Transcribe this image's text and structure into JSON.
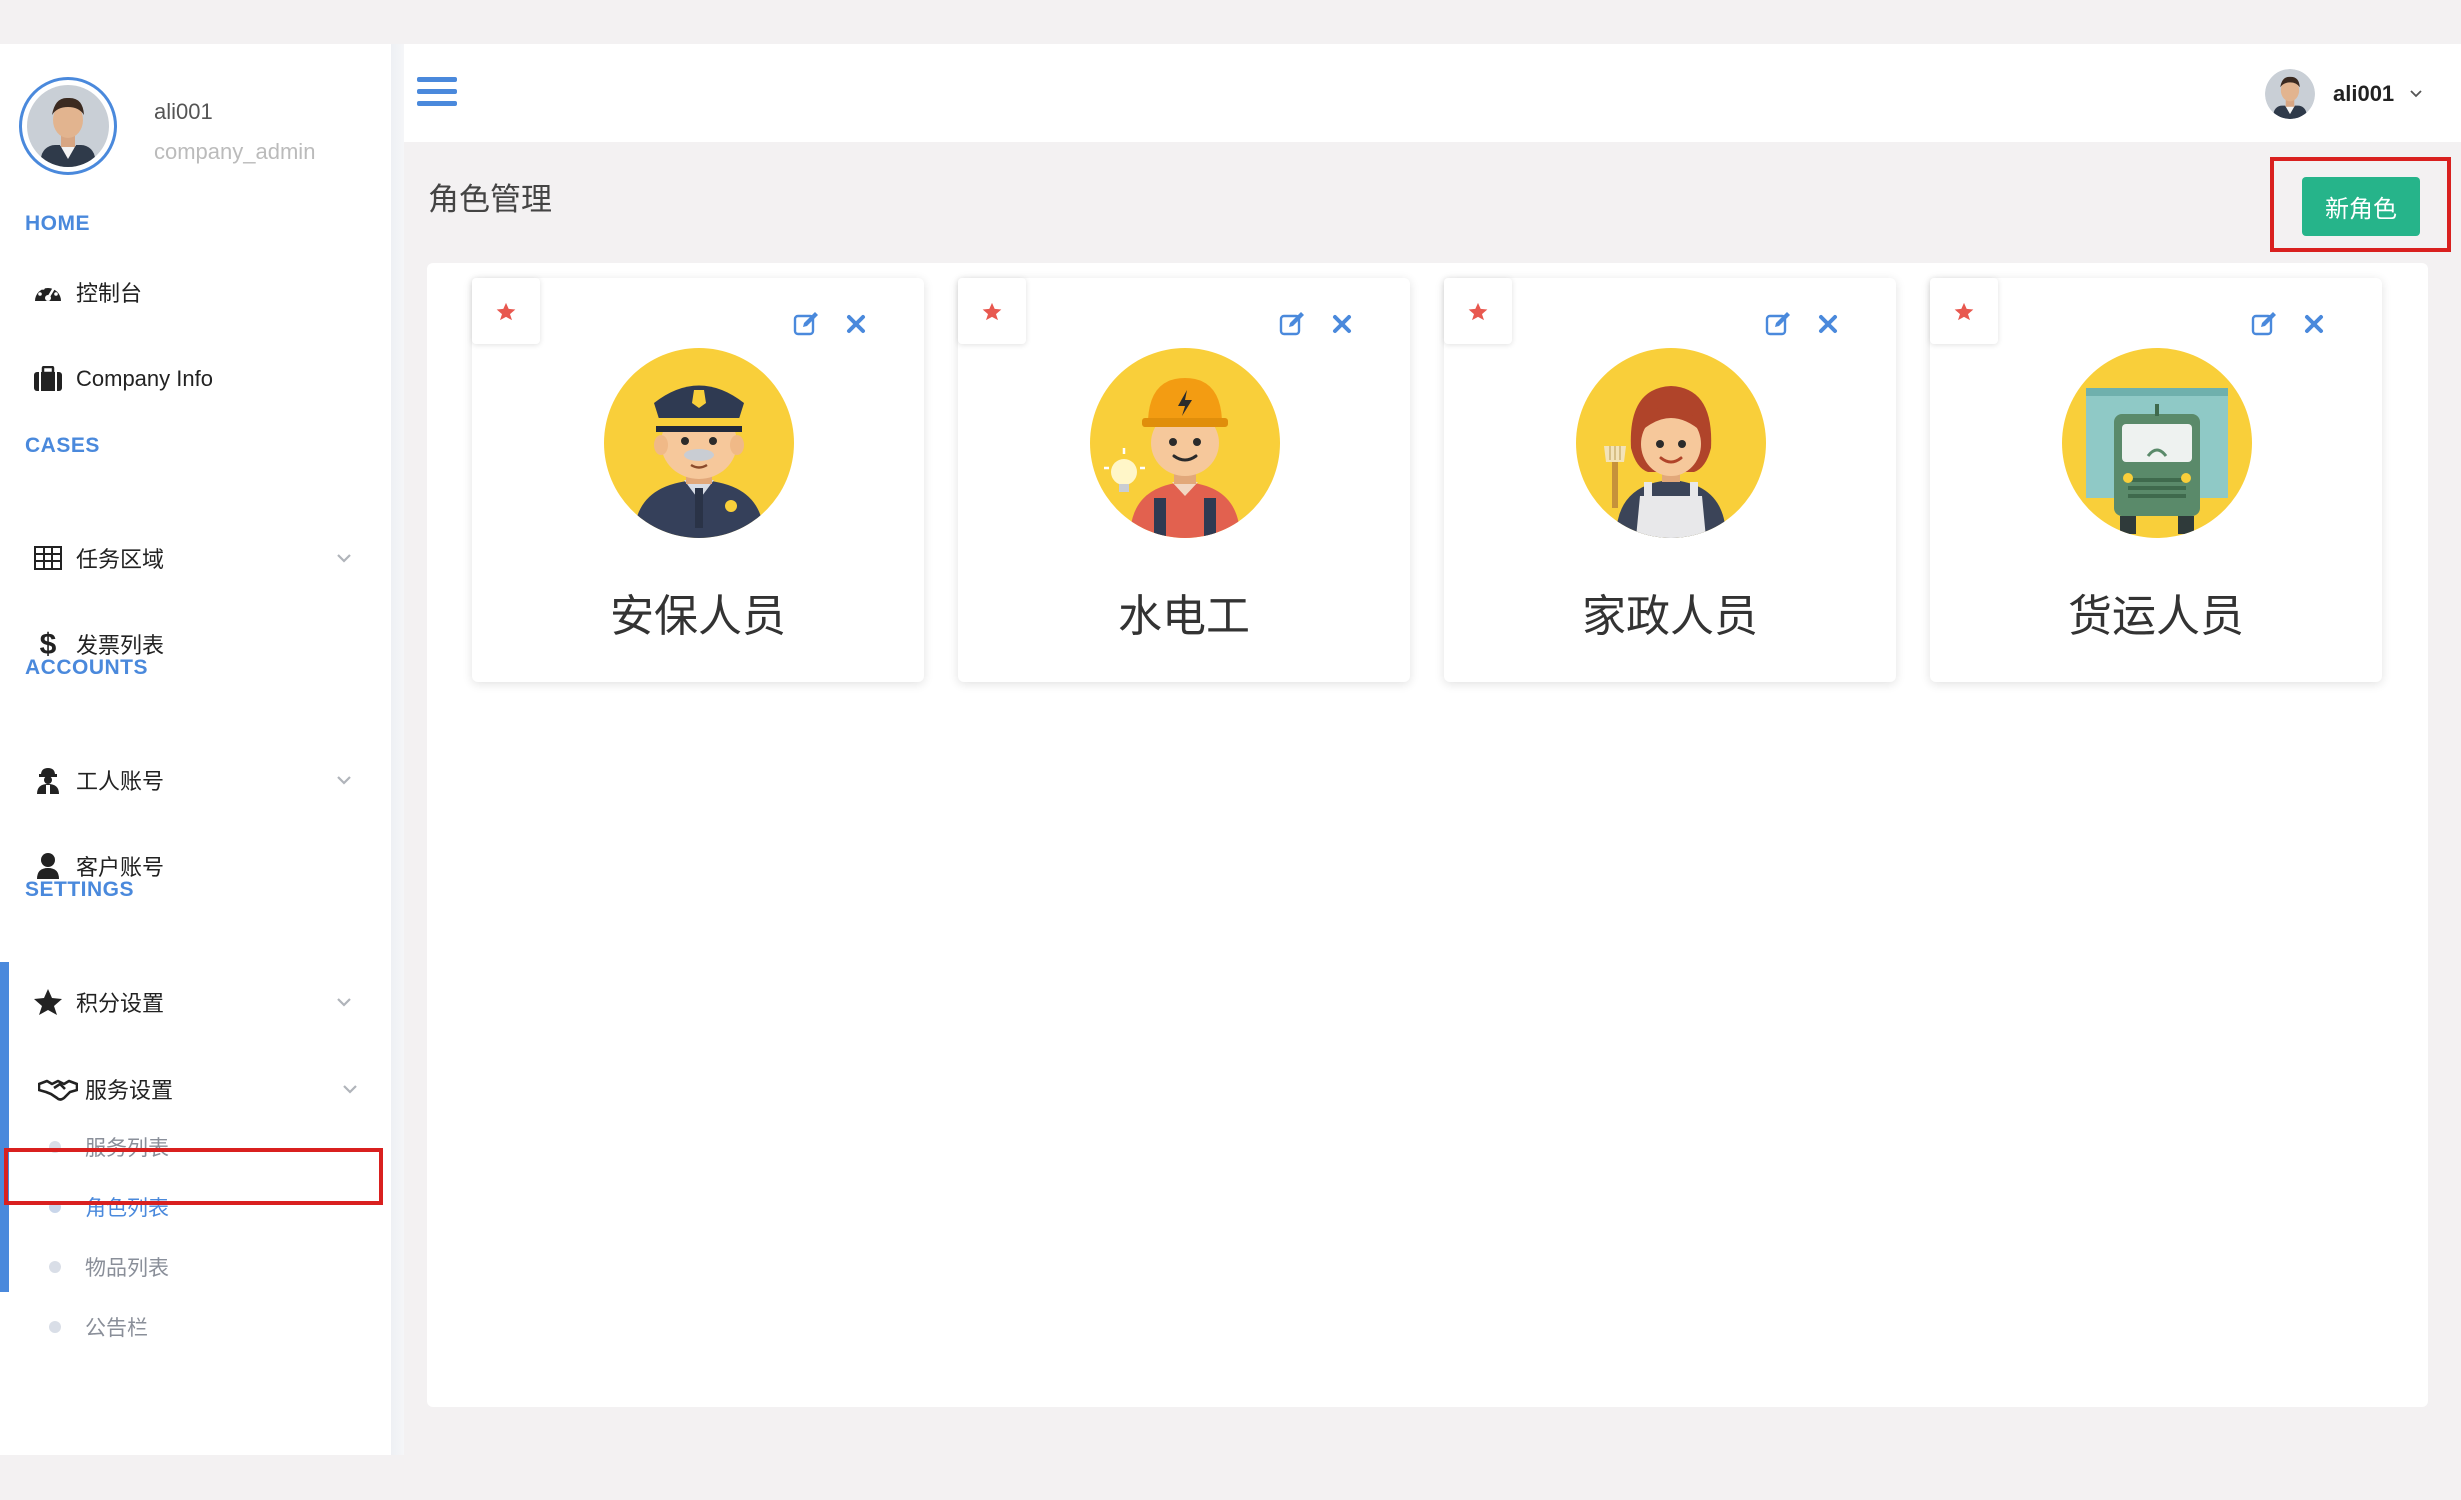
{
  "profile": {
    "name": "ali001",
    "role": "company_admin"
  },
  "sidebar": {
    "sections": [
      "HOME",
      "CASES",
      "ACCOUNTS",
      "SETTINGS"
    ],
    "items": [
      {
        "label": "控制台",
        "icon": "dashboard-icon"
      },
      {
        "label": "Company Info",
        "icon": "briefcase-icon"
      },
      {
        "label": "任务区域",
        "icon": "table-icon"
      },
      {
        "label": "发票列表",
        "icon": "dollar-icon"
      },
      {
        "label": "工人账号",
        "icon": "worker-icon"
      },
      {
        "label": "客户账号",
        "icon": "user-icon"
      },
      {
        "label": "积分设置",
        "icon": "star-icon"
      },
      {
        "label": "服务设置",
        "icon": "handshake-icon"
      }
    ],
    "sub_items": [
      "服务列表",
      "角色列表",
      "物品列表",
      "公告栏"
    ],
    "active_sub_item": "角色列表"
  },
  "topbar": {
    "user_name": "ali001"
  },
  "page": {
    "title": "角色管理",
    "new_button": "新角色"
  },
  "roles": [
    {
      "name": "安保人员",
      "icon": "security-guard-icon"
    },
    {
      "name": "水电工",
      "icon": "electrician-icon"
    },
    {
      "name": "家政人员",
      "icon": "housekeeper-icon"
    },
    {
      "name": "货运人员",
      "icon": "delivery-truck-icon"
    }
  ],
  "colors": {
    "accent": "#4a89dc",
    "primary_button": "#26b48a",
    "highlight_border": "#d9201f",
    "favorite_star": "#e8584f",
    "avatar_yellow": "#f9cf3a"
  }
}
